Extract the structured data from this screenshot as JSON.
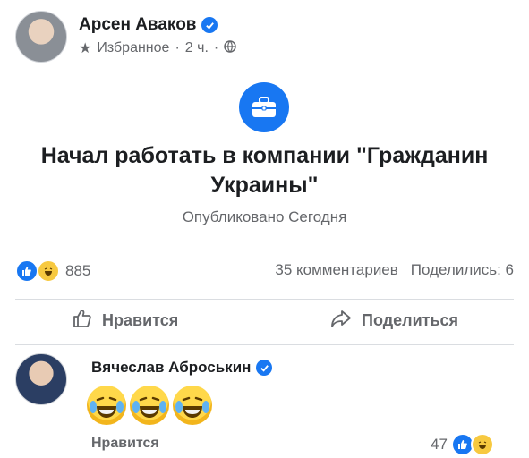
{
  "post": {
    "author": "Арсен Аваков",
    "audience": "Избранное",
    "time": "2 ч.",
    "separator": "·",
    "event_title": "Начал работать в компании \"Гражданин Украины\"",
    "event_subtitle": "Опубликовано Сегодня",
    "reaction_count": "885",
    "comments": "35 комментариев",
    "shares": "Поделились: 6"
  },
  "actions": {
    "like": "Нравится",
    "share": "Поделиться"
  },
  "comment": {
    "author": "Вячеслав Аброськин",
    "like_label": "Нравится",
    "reaction_count": "47"
  },
  "colors": {
    "accent": "#1877f2",
    "muted": "#65676b",
    "divider": "#dadde1"
  },
  "icons": [
    "verified-badge-icon",
    "star-icon",
    "globe-icon",
    "briefcase-icon",
    "like-reaction-icon",
    "haha-reaction-icon",
    "thumbs-up-icon",
    "share-arrow-icon",
    "laughing-tears-emoji"
  ]
}
